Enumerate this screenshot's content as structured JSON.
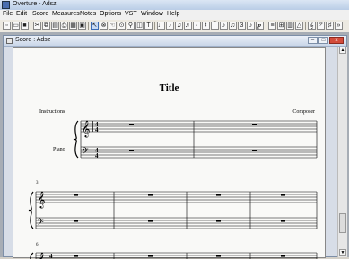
{
  "app": {
    "title": "Overture - Adsz"
  },
  "menu": [
    "File",
    "Edit",
    "Score",
    "Measures",
    "Notes",
    "Options",
    "VST",
    "Window",
    "Help"
  ],
  "toolbar": {
    "buttons": [
      "new-icon",
      "open-icon",
      "save-icon",
      "cut-icon",
      "copy-icon",
      "paste-icon",
      "print-icon",
      "arrow-tool-icon",
      "eraser-icon",
      "hand-icon",
      "zoom-icon",
      "note-tool-icon",
      "slur-icon",
      "text-tool-icon",
      "chord-icon",
      "mixer-icon",
      "metronome-icon",
      "keyboard-icon"
    ]
  },
  "document": {
    "title": "Score : Adsz",
    "controls": {
      "minimize": "–",
      "maximize": "□",
      "close": "x"
    }
  },
  "score": {
    "title": "Title",
    "instructions": "Instructions",
    "composer": "Composer",
    "instrument": "Piano",
    "time_signature": "4/4",
    "systems": [
      {
        "measure_number": "",
        "measures": 2
      },
      {
        "measure_number": "3",
        "measures": 4
      },
      {
        "measure_number": "6",
        "measures": 4
      }
    ]
  },
  "colors": {
    "accent": "#3a6bb5",
    "close": "#d34b3a",
    "workspace": "#a7adb5"
  }
}
